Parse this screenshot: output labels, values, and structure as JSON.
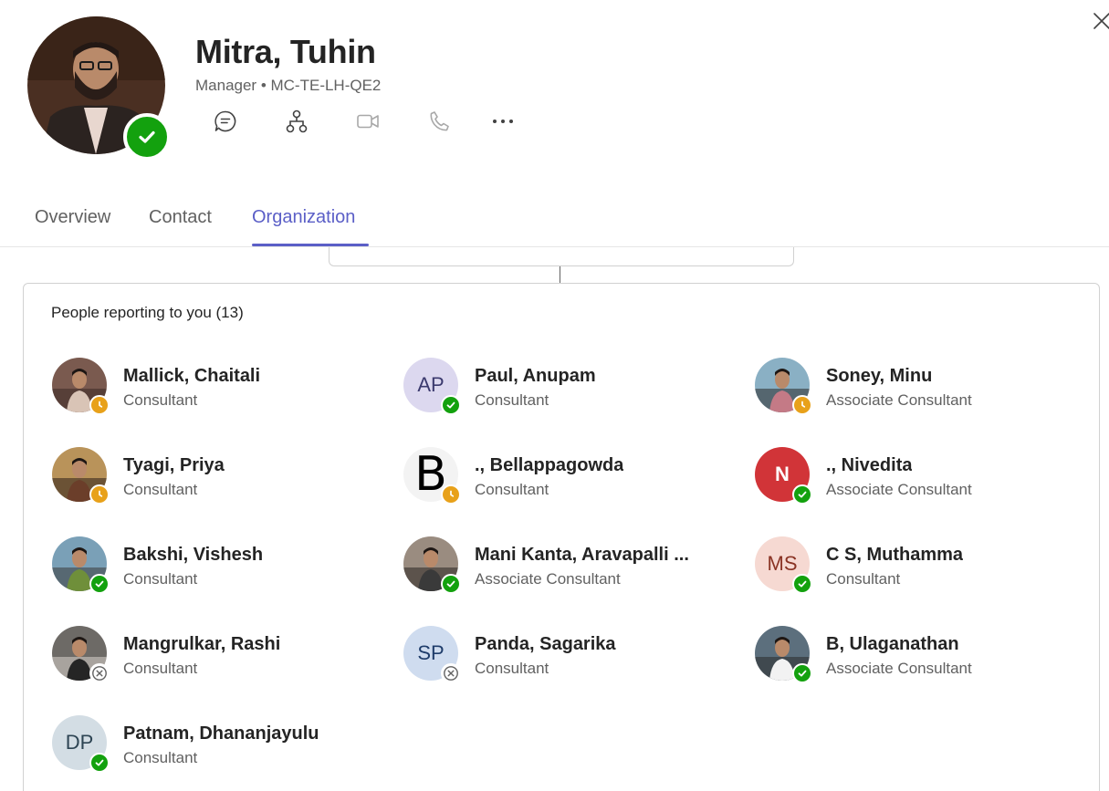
{
  "profile": {
    "name": "Mitra, Tuhin",
    "subtitle": "Manager • MC-TE-LH-QE2",
    "presence": "available"
  },
  "actions": [
    {
      "icon": "chat-icon",
      "label": "Chat"
    },
    {
      "icon": "org-chart-icon",
      "label": "Organization"
    },
    {
      "icon": "video-call-icon",
      "label": "Video call"
    },
    {
      "icon": "audio-call-icon",
      "label": "Audio call"
    },
    {
      "icon": "more-options-icon",
      "label": "More options"
    }
  ],
  "tabs": [
    {
      "label": "Overview",
      "active": false
    },
    {
      "label": "Contact",
      "active": false
    },
    {
      "label": "Organization",
      "active": true
    }
  ],
  "reports": {
    "heading": "People reporting to you (13)",
    "people": [
      {
        "name": "Mallick, Chaitali",
        "title": "Consultant",
        "avatar": "photo",
        "presence": "away"
      },
      {
        "name": "Paul, Anupam",
        "title": "Consultant",
        "avatar": "initials",
        "initials": "AP",
        "presence": "available"
      },
      {
        "name": "Soney, Minu",
        "title": "Associate Consultant",
        "avatar": "photo",
        "presence": "away"
      },
      {
        "name": "Tyagi, Priya",
        "title": "Consultant",
        "avatar": "photo",
        "presence": "away"
      },
      {
        "name": "., Bellappagowda",
        "title": "Consultant",
        "avatar": "letter",
        "initials": "B",
        "presence": "away"
      },
      {
        "name": "., Nivedita",
        "title": "Associate Consultant",
        "avatar": "initials",
        "initials": "N",
        "presence": "available"
      },
      {
        "name": "Bakshi, Vishesh",
        "title": "Consultant",
        "avatar": "photo",
        "presence": "available"
      },
      {
        "name": "Mani Kanta, Aravapalli ...",
        "title": "Associate Consultant",
        "avatar": "photo",
        "presence": "available"
      },
      {
        "name": "C S, Muthamma",
        "title": "Consultant",
        "avatar": "initials",
        "initials": "MS",
        "presence": "available"
      },
      {
        "name": "Mangrulkar, Rashi",
        "title": "Consultant",
        "avatar": "photo",
        "presence": "offline"
      },
      {
        "name": "Panda, Sagarika",
        "title": "Consultant",
        "avatar": "initials",
        "initials": "SP",
        "presence": "offline"
      },
      {
        "name": "B, Ulaganathan",
        "title": "Associate Consultant",
        "avatar": "photo",
        "presence": "available"
      },
      {
        "name": "Patnam, Dhananjayulu",
        "title": "Consultant",
        "avatar": "initials",
        "initials": "DP",
        "presence": "available"
      }
    ]
  },
  "colors": {
    "accent": "#5b5fc7",
    "available": "#13a10e",
    "away": "#e8a11a",
    "text_primary": "#242424",
    "text_secondary": "#616161"
  }
}
